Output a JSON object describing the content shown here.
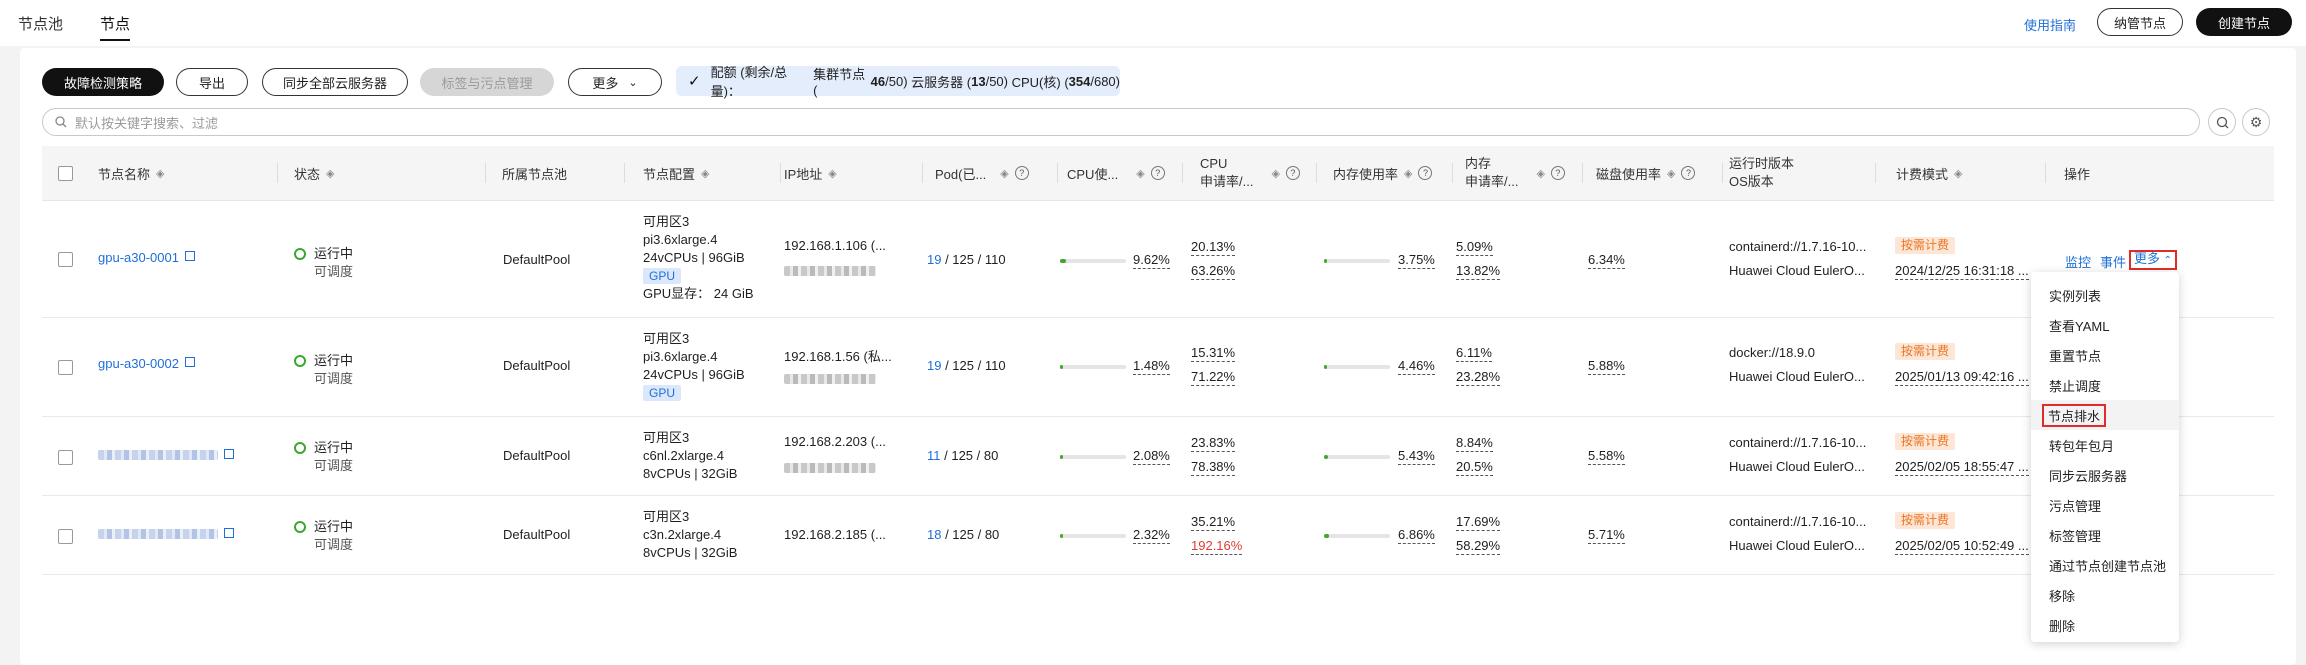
{
  "tabs": [
    {
      "label": "节点池"
    },
    {
      "label": "节点"
    }
  ],
  "header": {
    "guide_link": "使用指南",
    "manage_button": "纳管节点",
    "create_button": "创建节点"
  },
  "toolbar": {
    "fault_policy": "故障检测策略",
    "export": "导出",
    "sync_all": "同步全部云服务器",
    "labels_taints": "标签与污点管理",
    "more": "更多"
  },
  "quota": {
    "prefix": "配额 (剩余/总量)：",
    "cluster_label": "集群节点 (",
    "cluster_remaining": "46",
    "cluster_total": "/50)",
    "ecs_label": " 云服务器 (",
    "ecs_remaining": "13",
    "ecs_total": "/50)",
    "cpu_label": " CPU(核) (",
    "cpu_remaining": "354",
    "cpu_total": "/680)"
  },
  "search": {
    "placeholder": "默认按关键字搜索、过滤"
  },
  "columns": {
    "name": "节点名称",
    "status": "状态",
    "pool": "所属节点池",
    "config": "节点配置",
    "ip": "IP地址",
    "pod": "Pod(已...",
    "cpu_usage": "CPU使...",
    "cpu_req_1": "CPU",
    "cpu_req_2": "申请率/...",
    "mem_usage": "内存使用率",
    "mem_req_1": "内存",
    "mem_req_2": "申请率/...",
    "disk": "磁盘使用率",
    "runtime_1": "运行时版本",
    "runtime_2": "OS版本",
    "billing": "计费模式",
    "ops": "操作"
  },
  "rows": [
    {
      "name": "gpu-a30-0001",
      "status": "运行中",
      "status_sub": "可调度",
      "pool": "DefaultPool",
      "cfg_zone": "可用区3",
      "cfg_flavor": "pi3.6xlarge.4",
      "cfg_spec": "24vCPUs | 96GiB",
      "gpu_tag": "GPU",
      "gpu_mem": "GPU显存： 24 GiB",
      "ip": "192.168.1.106 (...",
      "pod_used": "19",
      "pod_rest": " / 125 / 110",
      "cpu_usage": "9.62%",
      "cpu_usage_pct": 9.62,
      "cpu_req1": "20.13%",
      "cpu_req2": "63.26%",
      "mem_usage": "3.75%",
      "mem_usage_pct": 3.75,
      "mem_req1": "5.09%",
      "mem_req2": "13.82%",
      "disk": "6.34%",
      "runtime": "containerd://1.7.16-10...",
      "os": "Huawei Cloud EulerO...",
      "billing": "按需计费",
      "billing_date": "2024/12/25 16:31:18 ..."
    },
    {
      "name": "gpu-a30-0002",
      "status": "运行中",
      "status_sub": "可调度",
      "pool": "DefaultPool",
      "cfg_zone": "可用区3",
      "cfg_flavor": "pi3.6xlarge.4",
      "cfg_spec": "24vCPUs | 96GiB",
      "gpu_tag": "GPU",
      "ip": "192.168.1.56 (私...",
      "pod_used": "19",
      "pod_rest": " / 125 / 110",
      "cpu_usage": "1.48%",
      "cpu_usage_pct": 1.48,
      "cpu_req1": "15.31%",
      "cpu_req2": "71.22%",
      "mem_usage": "4.46%",
      "mem_usage_pct": 4.46,
      "mem_req1": "6.11%",
      "mem_req2": "23.28%",
      "disk": "5.88%",
      "runtime": "docker://18.9.0",
      "os": "Huawei Cloud EulerO...",
      "billing": "按需计费",
      "billing_date": "2025/01/13 09:42:16 ..."
    },
    {
      "status": "运行中",
      "status_sub": "可调度",
      "pool": "DefaultPool",
      "cfg_zone": "可用区3",
      "cfg_flavor": "c6nl.2xlarge.4",
      "cfg_spec": "8vCPUs | 32GiB",
      "ip": "192.168.2.203 (...",
      "pod_used": "11",
      "pod_rest": " / 125 / 80",
      "cpu_usage": "2.08%",
      "cpu_usage_pct": 2.08,
      "cpu_req1": "23.83%",
      "cpu_req2": "78.38%",
      "mem_usage": "5.43%",
      "mem_usage_pct": 5.43,
      "mem_req1": "8.84%",
      "mem_req2": "20.5%",
      "disk": "5.58%",
      "runtime": "containerd://1.7.16-10...",
      "os": "Huawei Cloud EulerO...",
      "billing": "按需计费",
      "billing_date": "2025/02/05 18:55:47 ..."
    },
    {
      "status": "运行中",
      "status_sub": "可调度",
      "pool": "DefaultPool",
      "cfg_zone": "可用区3",
      "cfg_flavor": "c3n.2xlarge.4",
      "cfg_spec": "8vCPUs | 32GiB",
      "ip": "192.168.2.185 (...",
      "pod_used": "18",
      "pod_rest": " / 125 / 80",
      "cpu_usage": "2.32%",
      "cpu_usage_pct": 2.32,
      "cpu_req1": "35.21%",
      "cpu_req2": "192.16%",
      "mem_usage": "6.86%",
      "mem_usage_pct": 6.86,
      "mem_req1": "17.69%",
      "mem_req2": "58.29%",
      "disk": "5.71%",
      "runtime": "containerd://1.7.16-10...",
      "os": "Huawei Cloud EulerO...",
      "billing": "按需计费",
      "billing_date": "2025/02/05 10:52:49 ..."
    }
  ],
  "row_ops": {
    "monitor": "监控",
    "events": "事件",
    "more": "更多"
  },
  "more_menu": [
    "实例列表",
    "查看YAML",
    "重置节点",
    "禁止调度",
    "节点排水",
    "转包年包月",
    "同步云服务器",
    "污点管理",
    "标签管理",
    "通过节点创建节点池",
    "移除",
    "删除"
  ],
  "colors": {
    "accent": "#1f6fd9",
    "running": "#3aa72f",
    "danger": "#e53935",
    "billing": "#e97623"
  }
}
